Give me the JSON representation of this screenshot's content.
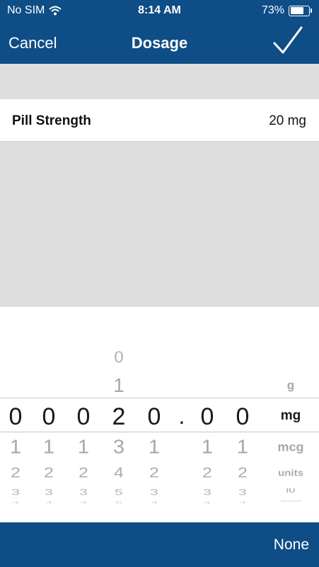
{
  "status_bar": {
    "carrier": "No SIM",
    "time": "8:14 AM",
    "battery": "73%",
    "battery_level": 0.73,
    "wifi_icon": "wifi-icon",
    "battery_icon": "battery-icon"
  },
  "nav": {
    "cancel": "Cancel",
    "title": "Dosage",
    "confirm_icon": "checkmark-icon"
  },
  "pill_strength": {
    "label": "Pill Strength",
    "value": "20 mg"
  },
  "picker": {
    "digit_columns": [
      {
        "above": [],
        "selected": "0",
        "below": [
          "1",
          "2",
          "3",
          "4"
        ]
      },
      {
        "above": [],
        "selected": "0",
        "below": [
          "1",
          "2",
          "3",
          "4"
        ]
      },
      {
        "above": [],
        "selected": "0",
        "below": [
          "1",
          "2",
          "3",
          "4"
        ]
      },
      {
        "above": [
          "0",
          "1"
        ],
        "selected": "2",
        "below": [
          "3",
          "4",
          "5",
          "6"
        ]
      },
      {
        "above": [],
        "selected": "0",
        "below": [
          "1",
          "2",
          "3",
          "4"
        ]
      },
      {
        "decimal_point": "."
      },
      {
        "above": [],
        "selected": "0",
        "below": [
          "1",
          "2",
          "3",
          "4"
        ]
      },
      {
        "above": [],
        "selected": "0",
        "below": [
          "1",
          "2",
          "3",
          "4"
        ]
      }
    ],
    "units": {
      "above": [
        "g"
      ],
      "selected": "mg",
      "below": [
        "mcg",
        "units",
        "IU",
        "mmol"
      ]
    }
  },
  "toolbar": {
    "none": "None"
  }
}
